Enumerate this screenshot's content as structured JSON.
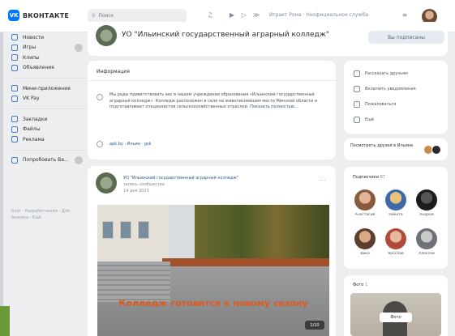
{
  "header": {
    "logo_mark": "VK",
    "logo_text": "ВКОНТАКТЕ",
    "search_placeholder": "Поиск",
    "status_text": "Играет Рома · Неофициальное служба"
  },
  "sidebar": {
    "items": [
      {
        "label": "Новости"
      },
      {
        "label": "Игры"
      },
      {
        "label": "Клипы"
      },
      {
        "label": "Объявления"
      },
      {
        "label": "Мини-приложения"
      },
      {
        "label": "VK Pay"
      },
      {
        "label": "Закладки"
      },
      {
        "label": "Файлы"
      },
      {
        "label": "Реклама"
      },
      {
        "label": "Попробовать Ва..."
      }
    ],
    "footer": "Блог · Разработчикам · Для бизнеса · Ещё"
  },
  "group": {
    "title": "УО \"Ильинский государственный аграрный колледж\"",
    "subscribed_label": "Вы подписаны"
  },
  "info": {
    "title": "Информация",
    "text": "Мы рады приветствовать вас в нашем учреждении образования «Ильинский государственный аграрный колледж». Колледж расположен в селе на живописнейшем месте Минской области и подготавливает специалистов сельскохозяйственных отраслей.",
    "more": "Показать полностью…",
    "link": "apk.by · Ильин · gsk"
  },
  "post": {
    "author": "УО \"Ильинский государственный аграрный колледж\"",
    "role": "запись сообщества",
    "date": "14 дек 2023",
    "overlay_text": "Колледж готовится к новому сезону",
    "photo_counter": "1/10"
  },
  "actions": {
    "items": [
      {
        "label": "Рассказать друзьям"
      },
      {
        "label": "Включить уведомления"
      },
      {
        "label": "Пожаловаться"
      },
      {
        "label": "Ещё"
      }
    ]
  },
  "friends": {
    "text": "Посмотреть друзей в Ильине"
  },
  "members": {
    "title": "Подписчики",
    "count": "87",
    "list": [
      {
        "name": "Анастасия"
      },
      {
        "name": "Никита"
      },
      {
        "name": "Андрей"
      },
      {
        "name": "Вика"
      },
      {
        "name": "Ярослав"
      },
      {
        "name": "Алексей"
      }
    ]
  },
  "photos": {
    "title": "Фото",
    "count": "1",
    "button_label": "Фото"
  },
  "colors": {
    "accent": "#0077ff",
    "link": "#2a5885",
    "background": "#edeef0",
    "overlay_text": "#e05a1c"
  }
}
